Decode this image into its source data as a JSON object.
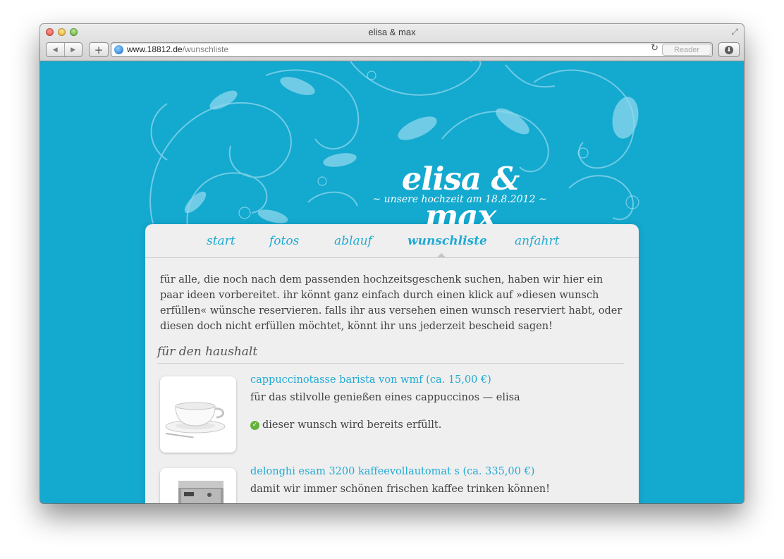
{
  "browser": {
    "window_title": "elisa & max",
    "url_host": "www.18812.de",
    "url_path": "/wunschliste",
    "reader_label": "Reader",
    "back_glyph": "◀",
    "forward_glyph": "▶",
    "add_glyph": "+",
    "reload_glyph": "↻",
    "fullscreen_glyph": "⤢",
    "download_glyph": "⬇"
  },
  "site": {
    "title": "elisa & max",
    "subtitle": "~ unsere hochzeit am 18.8.2012 ~"
  },
  "nav": {
    "items": [
      {
        "label": "start",
        "active": false
      },
      {
        "label": "fotos",
        "active": false
      },
      {
        "label": "ablauf",
        "active": false
      },
      {
        "label": "wunschliste",
        "active": true
      },
      {
        "label": "anfahrt",
        "active": false
      }
    ]
  },
  "intro": "für alle, die noch nach dem passenden hochzeitsgeschenk suchen, haben wir hier ein paar ideen vorbereitet. ihr könnt ganz einfach durch einen klick auf »diesen wunsch erfüllen« wünsche reservieren. falls ihr aus versehen einen wunsch reserviert habt, oder diesen doch nicht erfüllen möchtet, könnt ihr uns jederzeit bescheid sagen!",
  "section": {
    "heading": "für den haushalt"
  },
  "items": [
    {
      "title": "cappuccinotasse barista von wmf (ca. 15,00 €)",
      "description": "für das stilvolle genießen eines cappuccinos — elisa",
      "status": "dieser wunsch wird bereits erfüllt.",
      "status_icon": "check-icon"
    },
    {
      "title": "delonghi esam 3200 kaffeevollautomat s (ca. 335,00 €)",
      "description": "damit wir immer schönen frischen kaffee trinken können!"
    }
  ],
  "colors": {
    "background": "#14a9cf",
    "accent": "#20aad3",
    "text": "#404040",
    "success": "#65b33b"
  }
}
